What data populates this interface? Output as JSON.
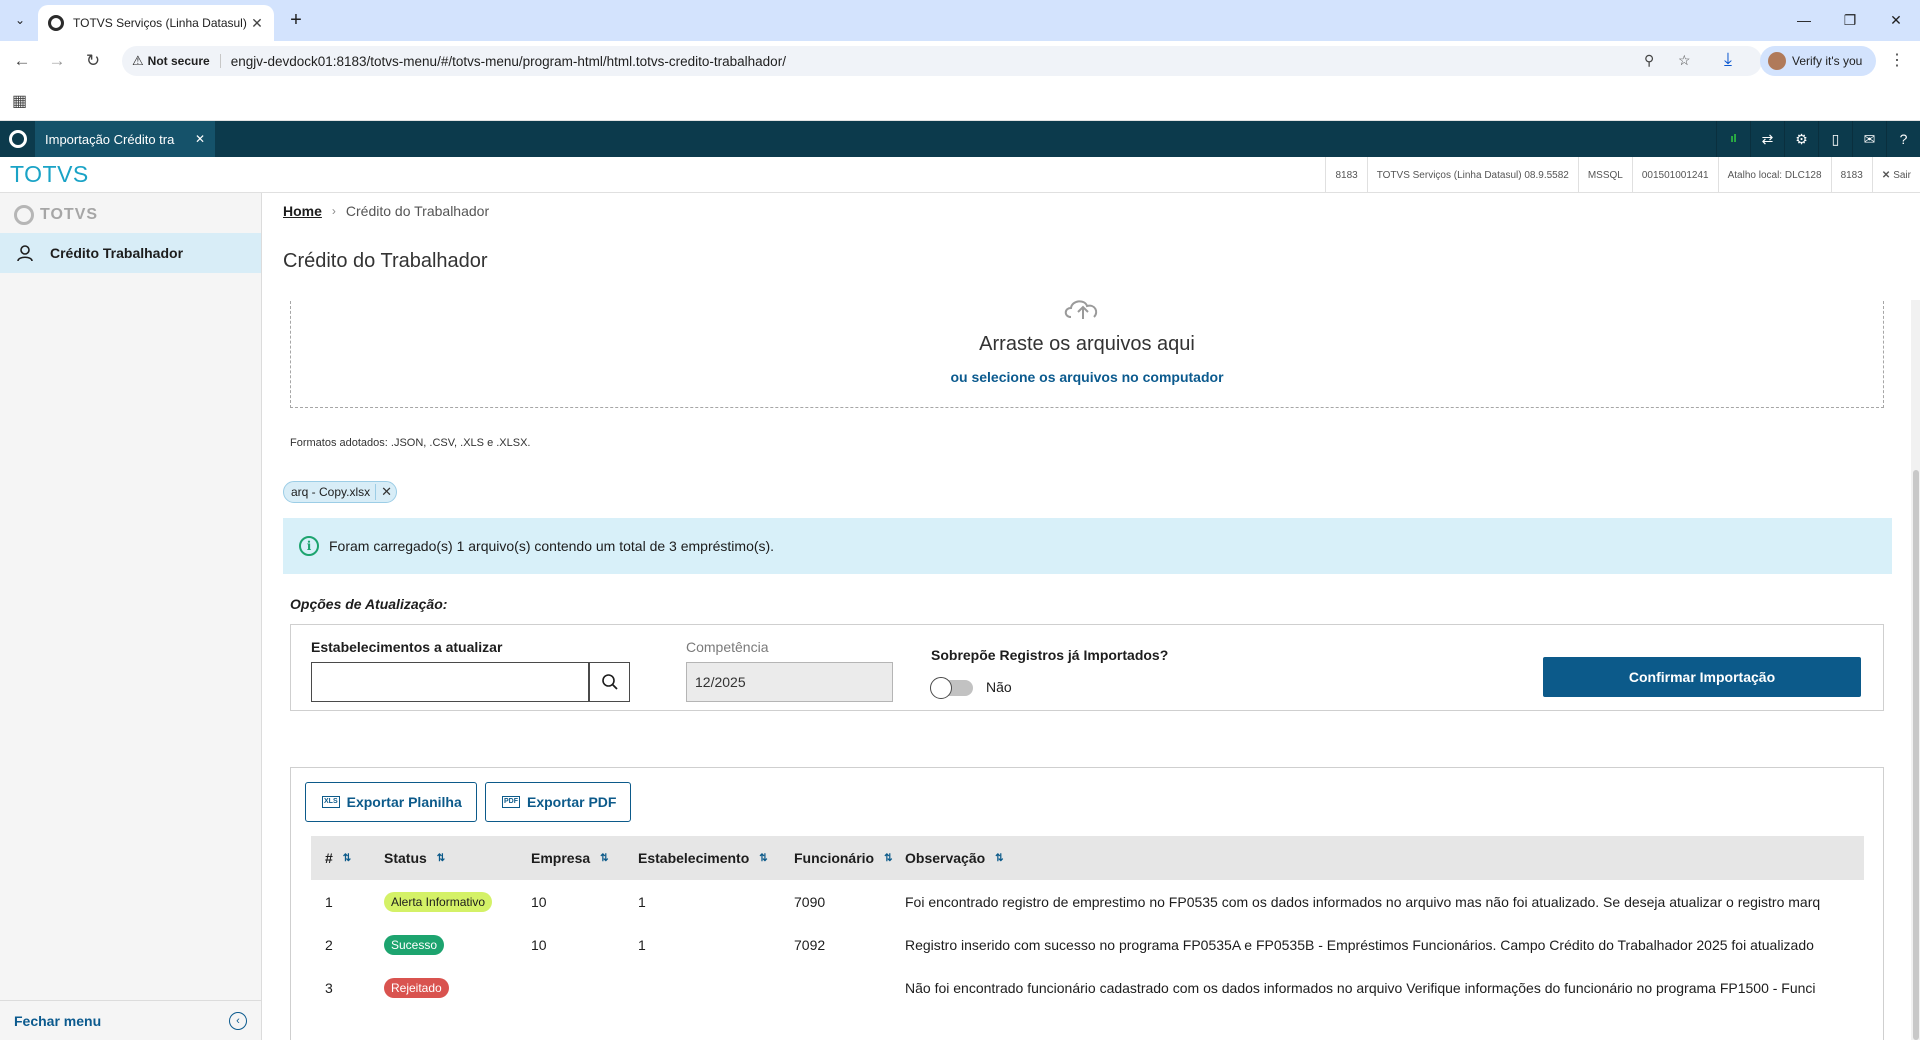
{
  "browser": {
    "tab_title": "TOTVS Serviços (Linha Datasul)",
    "not_secure_label": "Not secure",
    "url": "engjv-devdock01:8183/totvs-menu/#/totvs-menu/program-html/html.totvs-credito-trabalhador/",
    "verify_label": "Verify it's you"
  },
  "appbar": {
    "tab_title": "Importação Crédito tra",
    "signal_text": "ıl"
  },
  "infobar": {
    "brand": "TOTVS",
    "cells": [
      "8183",
      "TOTVS Serviços (Linha Datasul) 08.9.5582",
      "MSSQL",
      "001501001241",
      "Atalho local: DLC128",
      "8183",
      "Sair"
    ]
  },
  "sidemenu": {
    "logo_text": "TOTVS",
    "item_label": "Crédito Trabalhador",
    "footer_label": "Fechar menu"
  },
  "content": {
    "breadcrumb": {
      "home": "Home",
      "current": "Crédito do Trabalhador"
    },
    "page_title": "Crédito do Trabalhador",
    "dropzone": {
      "title": "Arraste os arquivos aqui",
      "link": "ou selecione os arquivos no computador"
    },
    "formats": "Formatos adotados: .JSON, .CSV, .XLS e .XLSX.",
    "file_tag": "arq - Copy.xlsx",
    "alert_text": "Foram carregado(s) 1 arquivo(s) contendo um total de 3 empréstimo(s).",
    "options": {
      "section_title": "Opções de Atualização:",
      "est_label": "Estabelecimentos a atualizar",
      "est_value": "",
      "comp_label": "Competência",
      "comp_value": "12/2025",
      "overwrite_label": "Sobrepõe Registros já Importados?",
      "overwrite_state": "Não",
      "confirm_label": "Confirmar Importação"
    },
    "exports": {
      "xls_icon": "XLS",
      "xls_label": "Exportar Planilha",
      "pdf_icon": "PDF",
      "pdf_label": "Exportar PDF"
    },
    "table": {
      "headers": [
        "#",
        "Status",
        "Empresa",
        "Estabelecimento",
        "Funcionário",
        "Observação"
      ],
      "rows": [
        {
          "n": "1",
          "status": "Alerta Informativo",
          "empresa": "10",
          "estab": "1",
          "func": "7090",
          "obs": "Foi encontrado registro de emprestimo no FP0535 com os dados informados no arquivo mas não foi atualizado. Se deseja atualizar o registro marq"
        },
        {
          "n": "2",
          "status": "Sucesso",
          "empresa": "10",
          "estab": "1",
          "func": "7092",
          "obs": "Registro inserido com sucesso no programa FP0535A e FP0535B - Empréstimos Funcionários. Campo Crédito do Trabalhador 2025 foi atualizado"
        },
        {
          "n": "3",
          "status": "Rejeitado",
          "empresa": "",
          "estab": "",
          "func": "",
          "obs": "Não foi encontrado funcionário cadastrado com os dados informados no arquivo Verifique informações do funcionário no programa FP1500 - Funci"
        }
      ]
    }
  },
  "colors": {
    "appbar": "#0c3a4c",
    "brand": "#1aa3c6",
    "primary": "#0c5a8a",
    "alert_bg": "#d8f0f9",
    "success": "#1da46f",
    "warning": "#d4f167",
    "danger": "#d9534f"
  }
}
